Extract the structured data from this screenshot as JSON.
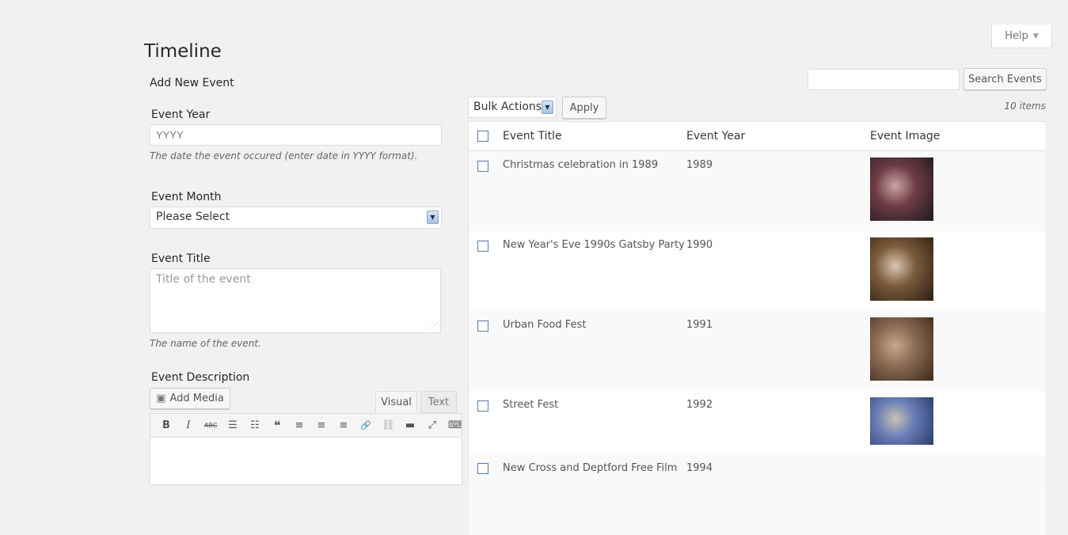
{
  "help": {
    "label": "Help"
  },
  "page": {
    "title": "Timeline"
  },
  "form": {
    "title": "Add New Event",
    "year": {
      "label": "Event Year",
      "placeholder": "YYYY",
      "help": "The date the event occured (enter date in YYYY format)."
    },
    "month": {
      "label": "Event Month",
      "selected": "Please Select"
    },
    "title_field": {
      "label": "Event Title",
      "placeholder": "Title of the event",
      "help": "The name of the event."
    },
    "description": {
      "label": "Event Description",
      "add_media": "Add Media",
      "tab_visual": "Visual",
      "tab_text": "Text"
    }
  },
  "toolbar": {
    "bold": "B",
    "italic": "I",
    "strike": "ABC",
    "ul": "☰",
    "ol": "☷",
    "quote": "❝",
    "align_left": "≡",
    "align_center": "≡",
    "align_right": "≡",
    "link": "🔗",
    "unlink": "⛓",
    "more": "▬",
    "fullscreen": "⤢",
    "kitchen": "⌨"
  },
  "list": {
    "search_button": "Search Events",
    "bulk_actions": "Bulk Actions",
    "apply": "Apply",
    "items_count": "10 items",
    "columns": [
      "Event Title",
      "Event Year",
      "Event Image"
    ],
    "rows": [
      {
        "title": "Christmas celebration in 1989",
        "year": "1989",
        "image_colors": [
          "#1c1a1e",
          "#6e3b45",
          "#c9a3a8"
        ]
      },
      {
        "title": "New Year's Eve 1990s Gatsby Party",
        "year": "1990",
        "image_colors": [
          "#2b1e14",
          "#7a5a3a",
          "#d8c6b2"
        ]
      },
      {
        "title": "Urban Food Fest",
        "year": "1991",
        "image_colors": [
          "#3a2a1e",
          "#8b6a52",
          "#c7a98f"
        ]
      },
      {
        "title": "Street Fest",
        "year": "1992",
        "image_colors": [
          "#2a3a6a",
          "#6a7fb8",
          "#c9c2b0"
        ]
      },
      {
        "title": "New Cross and Deptford Free Film",
        "year": "1994",
        "image_colors": []
      }
    ]
  }
}
